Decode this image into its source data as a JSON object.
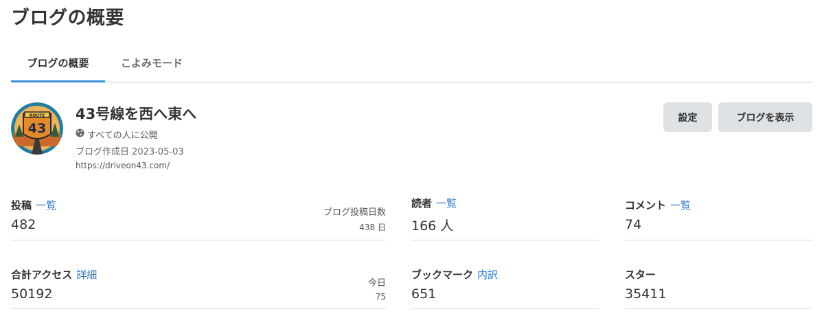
{
  "page": {
    "title": "ブログの概要"
  },
  "tabs": [
    {
      "label": "ブログの概要"
    },
    {
      "label": "こよみモード"
    }
  ],
  "blog": {
    "name": "43号線を西へ東へ",
    "visibility": "すべての人に公開",
    "created": "ブログ作成日 2023-05-03",
    "url": "https://driveon43.com/",
    "icon_text": "43",
    "icon_route": "ROUTE"
  },
  "buttons": {
    "settings": "設定",
    "view_blog": "ブログを表示"
  },
  "stats": {
    "posts": {
      "label": "投稿",
      "link": "一覧",
      "value": "482",
      "sub_label": "ブログ投稿日数",
      "sub_value": "438 日"
    },
    "readers": {
      "label": "読者",
      "link": "一覧",
      "value": "166 人"
    },
    "comments": {
      "label": "コメント",
      "link": "一覧",
      "value": "74"
    },
    "access": {
      "label": "合計アクセス",
      "link": "詳細",
      "value": "50192",
      "sub_label": "今日",
      "sub_value": "75"
    },
    "bookmarks": {
      "label": "ブックマーク",
      "link": "内訳",
      "value": "651"
    },
    "stars": {
      "label": "スター",
      "value": "35411"
    }
  },
  "colors": {
    "accent": "#3b8ed9",
    "link": "#2f7ad0",
    "button_bg": "#dfe2e5",
    "icon_bg": "#1f7ea1",
    "icon_sign": "#e58a2b"
  }
}
